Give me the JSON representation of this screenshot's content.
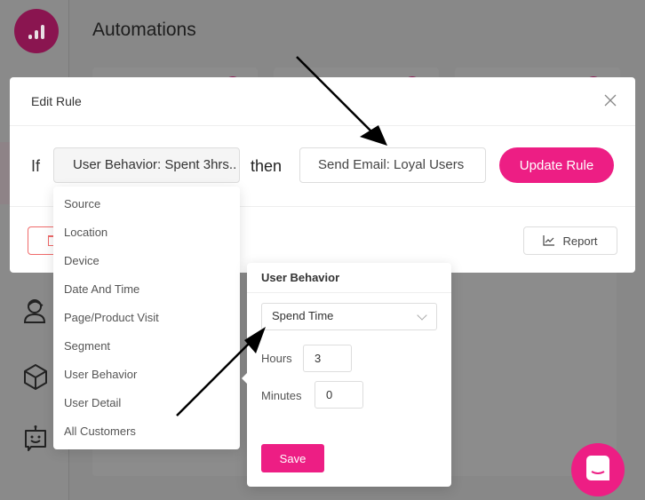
{
  "app": {
    "page_title": "Automations",
    "brand_color": "#8a1550",
    "accent_color": "#ed1e84"
  },
  "sidebar": {
    "icons": [
      "logo-bars-icon",
      "user-headset-icon",
      "cube-icon",
      "bot-icon"
    ]
  },
  "modal": {
    "title": "Edit Rule",
    "if_label": "If",
    "condition_value": "User Behavior: Spent 3hrs..",
    "then_label": "then",
    "action_value": "Send Email: Loyal Users",
    "update_button": "Update Rule",
    "report_button": "Report"
  },
  "condition_dropdown": {
    "items": [
      "Source",
      "Location",
      "Device",
      "Date And Time",
      "Page/Product Visit",
      "Segment",
      "User Behavior",
      "User Detail",
      "All Customers"
    ]
  },
  "user_behavior_popover": {
    "title": "User Behavior",
    "behavior_select": "Spend Time",
    "hours_label": "Hours",
    "hours_value": "3",
    "minutes_label": "Minutes",
    "minutes_value": "0",
    "save_button": "Save"
  }
}
